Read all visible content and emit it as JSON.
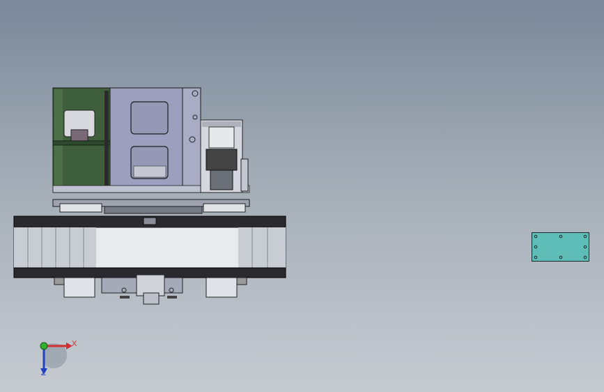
{
  "viewport": {
    "background_top": "#7a8899",
    "background_bottom": "#c6cbd1"
  },
  "model": {
    "parts": [
      "green-housing-left",
      "gray-frame-center",
      "cylinder-assembly-right",
      "turntable-ring",
      "lower-bearings",
      "center-shaft-mount"
    ],
    "colors": {
      "green_housing": "#3f5f3c",
      "frame": "#9c9fbe",
      "ring": "#2a2a2e",
      "ring_face": "#e8eaee",
      "plate": "#5fbdb7"
    }
  },
  "triad": {
    "x_label": "X",
    "z_label": "Z",
    "x_color": "#d03030",
    "y_color": "#30b030",
    "z_color": "#2040c0"
  }
}
